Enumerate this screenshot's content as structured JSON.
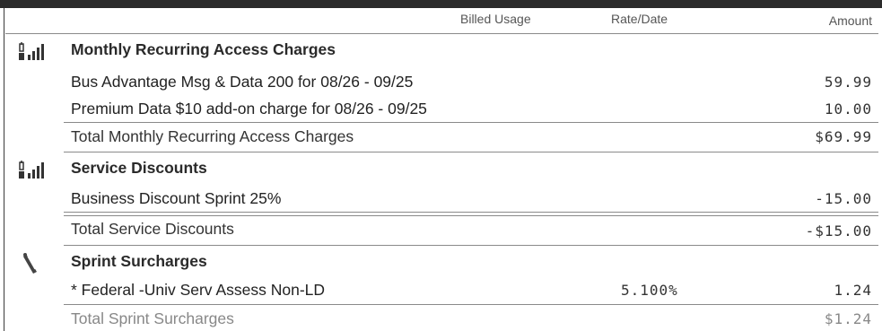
{
  "header": {
    "billed_usage": "Billed Usage",
    "rate_date": "Rate/Date",
    "amount": "Amount"
  },
  "sections": [
    {
      "title": "Monthly Recurring Access Charges",
      "icon": "signal-bars-icon",
      "items": [
        {
          "label": "Bus Advantage Msg & Data 200 for 08/26 - 09/25",
          "amount": "59.99"
        },
        {
          "label": "Premium Data $10 add-on charge for 08/26 - 09/25",
          "amount": "10.00"
        }
      ],
      "total": {
        "label": "Total Monthly Recurring Access Charges",
        "amount": "$69.99"
      }
    },
    {
      "title": "Service Discounts",
      "icon": "signal-bars-icon",
      "items": [
        {
          "label": "Business Discount Sprint 25%",
          "amount": "-15.00"
        }
      ],
      "total": {
        "label": "Total Service Discounts",
        "amount": "-$15.00"
      }
    },
    {
      "title": "Sprint Surcharges",
      "icon": "paperclip-icon",
      "items": [
        {
          "label": "* Federal -Univ Serv Assess Non-LD",
          "rate": "5.100%",
          "amount": "1.24"
        }
      ],
      "total": {
        "label": "Total Sprint Surcharges",
        "amount": "$1.24"
      }
    }
  ]
}
